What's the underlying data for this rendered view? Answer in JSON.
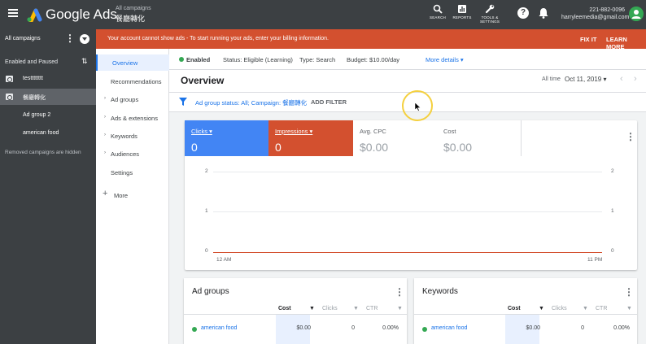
{
  "app": {
    "brand": "Google Ads",
    "crumb_top": "All campaigns",
    "crumb_sub": "餐廳轉化"
  },
  "toolbar": {
    "search_label": "SEARCH",
    "reports_label": "REPORTS",
    "tools_label_1": "TOOLS &",
    "tools_label_2": "SETTINGS",
    "help_label": "?"
  },
  "account": {
    "phone": "221-882-0096",
    "email": "harryleemedia@gmail.com"
  },
  "left": {
    "all_campaigns": "All campaigns",
    "filter_label": "Enabled and Paused",
    "campaigns": [
      {
        "label": "testttttttt"
      },
      {
        "label": "餐廳轉化"
      }
    ],
    "ad_groups": [
      {
        "label": "Ad group 2"
      },
      {
        "label": "american food"
      }
    ],
    "removed_note": "Removed campaigns are hidden"
  },
  "nav": {
    "items": [
      {
        "label": "Overview"
      },
      {
        "label": "Recommendations"
      },
      {
        "label": "Ad groups"
      },
      {
        "label": "Ads & extensions"
      },
      {
        "label": "Keywords"
      },
      {
        "label": "Audiences"
      },
      {
        "label": "Settings"
      }
    ],
    "more": "More",
    "plus": "+"
  },
  "alert": {
    "message": "Your account cannot show ads - To start running your ads, enter your billing information.",
    "fix": "FIX IT",
    "learn": "LEARN MORE"
  },
  "status": {
    "enabled": "Enabled",
    "status": "Status: Eligible (Learning)",
    "type": "Type: Search",
    "budget": "Budget: $10.00/day",
    "more": "More details ▾"
  },
  "overview": {
    "title": "Overview",
    "range_label": "All time",
    "date": "Oct 11, 2019 ▾"
  },
  "filter": {
    "text": "Ad group status: All; Campaign: 餐廳轉化",
    "add": "ADD FILTER"
  },
  "metrics": [
    {
      "label": "Clicks ▾",
      "value": "0"
    },
    {
      "label": "Impressions ▾",
      "value": "0"
    },
    {
      "label": "Avg. CPC",
      "value": "$0.00"
    },
    {
      "label": "Cost",
      "value": "$0.00"
    }
  ],
  "chart_data": {
    "type": "line",
    "x": [
      "12 AM",
      "11 PM"
    ],
    "series": [
      {
        "values": [
          0,
          0
        ],
        "color": "#d3502f"
      }
    ],
    "y_ticks": [
      "2",
      "1",
      "0"
    ],
    "ylim": [
      0,
      2
    ],
    "grid": true
  },
  "adgroups_card": {
    "title": "Ad groups",
    "headers": [
      "Cost",
      "Clicks",
      "CTR"
    ],
    "rows": [
      {
        "name": "american food",
        "cost": "$0.00",
        "clicks": "0",
        "ctr": "0.00%"
      }
    ]
  },
  "keywords_card": {
    "title": "Keywords",
    "headers": [
      "Cost",
      "Clicks",
      "CTR"
    ],
    "rows": [
      {
        "name": "american food",
        "cost": "$0.00",
        "clicks": "0",
        "ctr": "0.00%"
      }
    ]
  },
  "colors": {
    "topbar": "#3c4043",
    "alert": "#d3502f",
    "clicks": "#4285f4",
    "impressions": "#d3502f",
    "link": "#1a73e8",
    "enabled": "#34a853"
  }
}
